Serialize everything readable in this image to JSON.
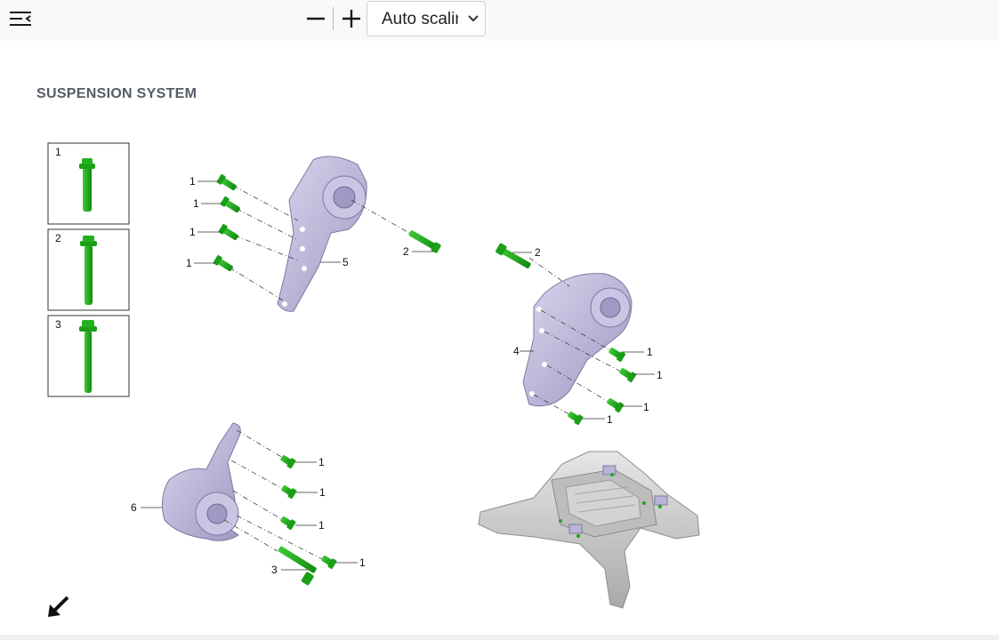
{
  "toolbar": {
    "sidebar_toggle_icon": "sidebar-toggle-icon",
    "zoom_out_icon": "minus-icon",
    "zoom_in_icon": "plus-icon",
    "scale_select_value": "Auto scaling"
  },
  "page": {
    "title": "SUSPENSION SYSTEM"
  },
  "legend": [
    {
      "number": "1"
    },
    {
      "number": "2"
    },
    {
      "number": "3"
    }
  ],
  "callouts": {
    "bolt_1": "1",
    "bolt_2": "2",
    "bolt_3": "3",
    "mount_4": "4",
    "mount_5": "5",
    "mount_6": "6"
  },
  "colors": {
    "bolt_green": "#1fa51a",
    "bracket_lavender": "#b9b6d6",
    "subframe_gray": "#c9c9c9"
  }
}
